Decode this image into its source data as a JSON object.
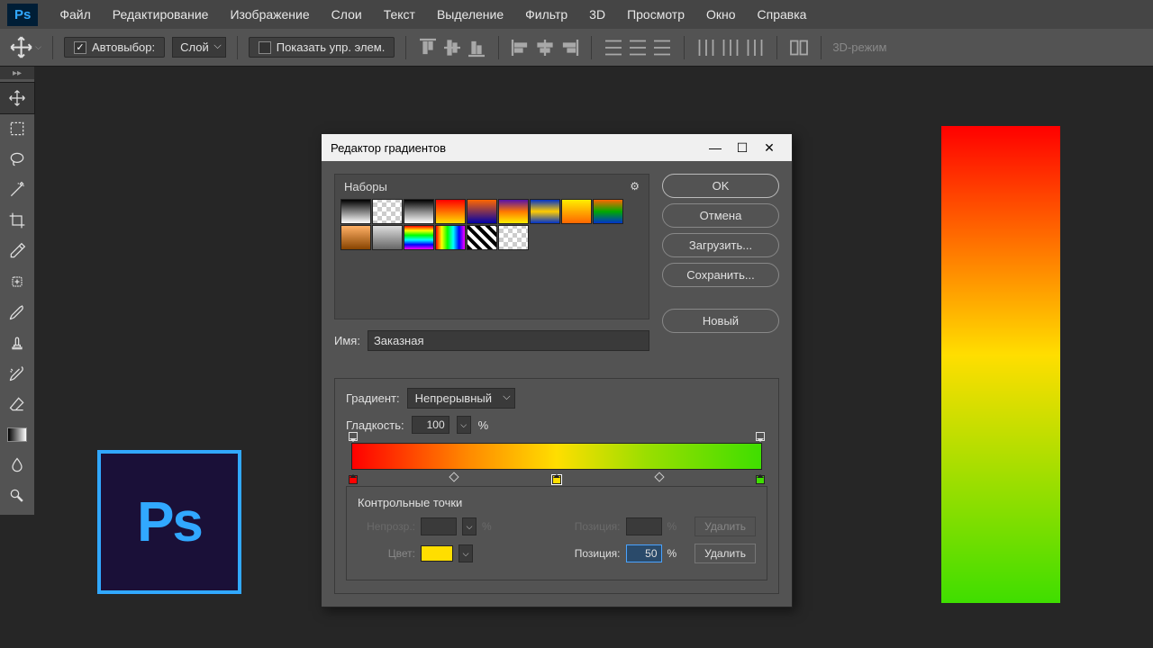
{
  "menubar": {
    "items": [
      "Файл",
      "Редактирование",
      "Изображение",
      "Слои",
      "Текст",
      "Выделение",
      "Фильтр",
      "3D",
      "Просмотр",
      "Окно",
      "Справка"
    ]
  },
  "optionsbar": {
    "autoselect_label": "Автовыбор:",
    "autoselect_checked": true,
    "target_select": "Слой",
    "show_transform_label": "Показать упр. элем.",
    "show_transform_checked": false,
    "mode3d": "3D-режим"
  },
  "dialog": {
    "title": "Редактор градиентов",
    "presets_label": "Наборы",
    "buttons": {
      "ok": "OK",
      "cancel": "Отмена",
      "load": "Загрузить...",
      "save": "Сохранить...",
      "new": "Новый"
    },
    "name_label": "Имя:",
    "name_value": "Заказная",
    "gradient_type_label": "Градиент:",
    "gradient_type_value": "Непрерывный",
    "smoothness_label": "Гладкость:",
    "smoothness_value": "100",
    "percent": "%",
    "stops_title": "Контрольные точки",
    "opacity_label": "Непрозр.:",
    "position_label": "Позиция:",
    "position_value": "50",
    "color_label": "Цвет:",
    "color_value": "#ffde00",
    "delete": "Удалить"
  },
  "gradient": {
    "opacity_stops": [
      0,
      100
    ],
    "color_stops": [
      {
        "pos": 0,
        "color": "#ff0000"
      },
      {
        "pos": 50,
        "color": "#ffde00"
      },
      {
        "pos": 100,
        "color": "#3fde00"
      }
    ],
    "midpoints": [
      25,
      75
    ]
  },
  "presets": {
    "row1": [
      "linear-gradient(to bottom,#000,#fff)",
      "repeating-conic-gradient(#ccc 0 25%,#fff 0 50%) 0/10px 10px",
      "linear-gradient(to bottom,#000,#888,#fff)",
      "linear-gradient(to bottom,#ff0000,#ffdd00)",
      "linear-gradient(to bottom,#ff6600,#0000aa)",
      "linear-gradient(to bottom,#5511aa,#ff7700,#ffee00)",
      "linear-gradient(to bottom,#0033cc,#ffcc00,#0033cc)",
      "linear-gradient(to bottom,#ffee00,#ff6600)",
      "linear-gradient(to bottom,#ff6600,#00aa00,#0033cc)"
    ],
    "row2": [
      "linear-gradient(to bottom,#ffb066,#884400)",
      "linear-gradient(to bottom,#dddddd,#666666)",
      "linear-gradient(to bottom,#ff0000,#ffff00,#00ff00,#00ffff,#0000ff,#ff00ff)",
      "linear-gradient(to right,#ff0000,#ffff00,#00ff00,#00ffff,#0000ff,#ff00ff)",
      "repeating-linear-gradient(45deg,#000 0 4px,#fff 4px 8px)",
      "repeating-conic-gradient(#ccc 0 25%,#fff 0 50%) 0/10px 10px"
    ]
  },
  "ps_badge": "Ps",
  "ps_logo": "Ps"
}
